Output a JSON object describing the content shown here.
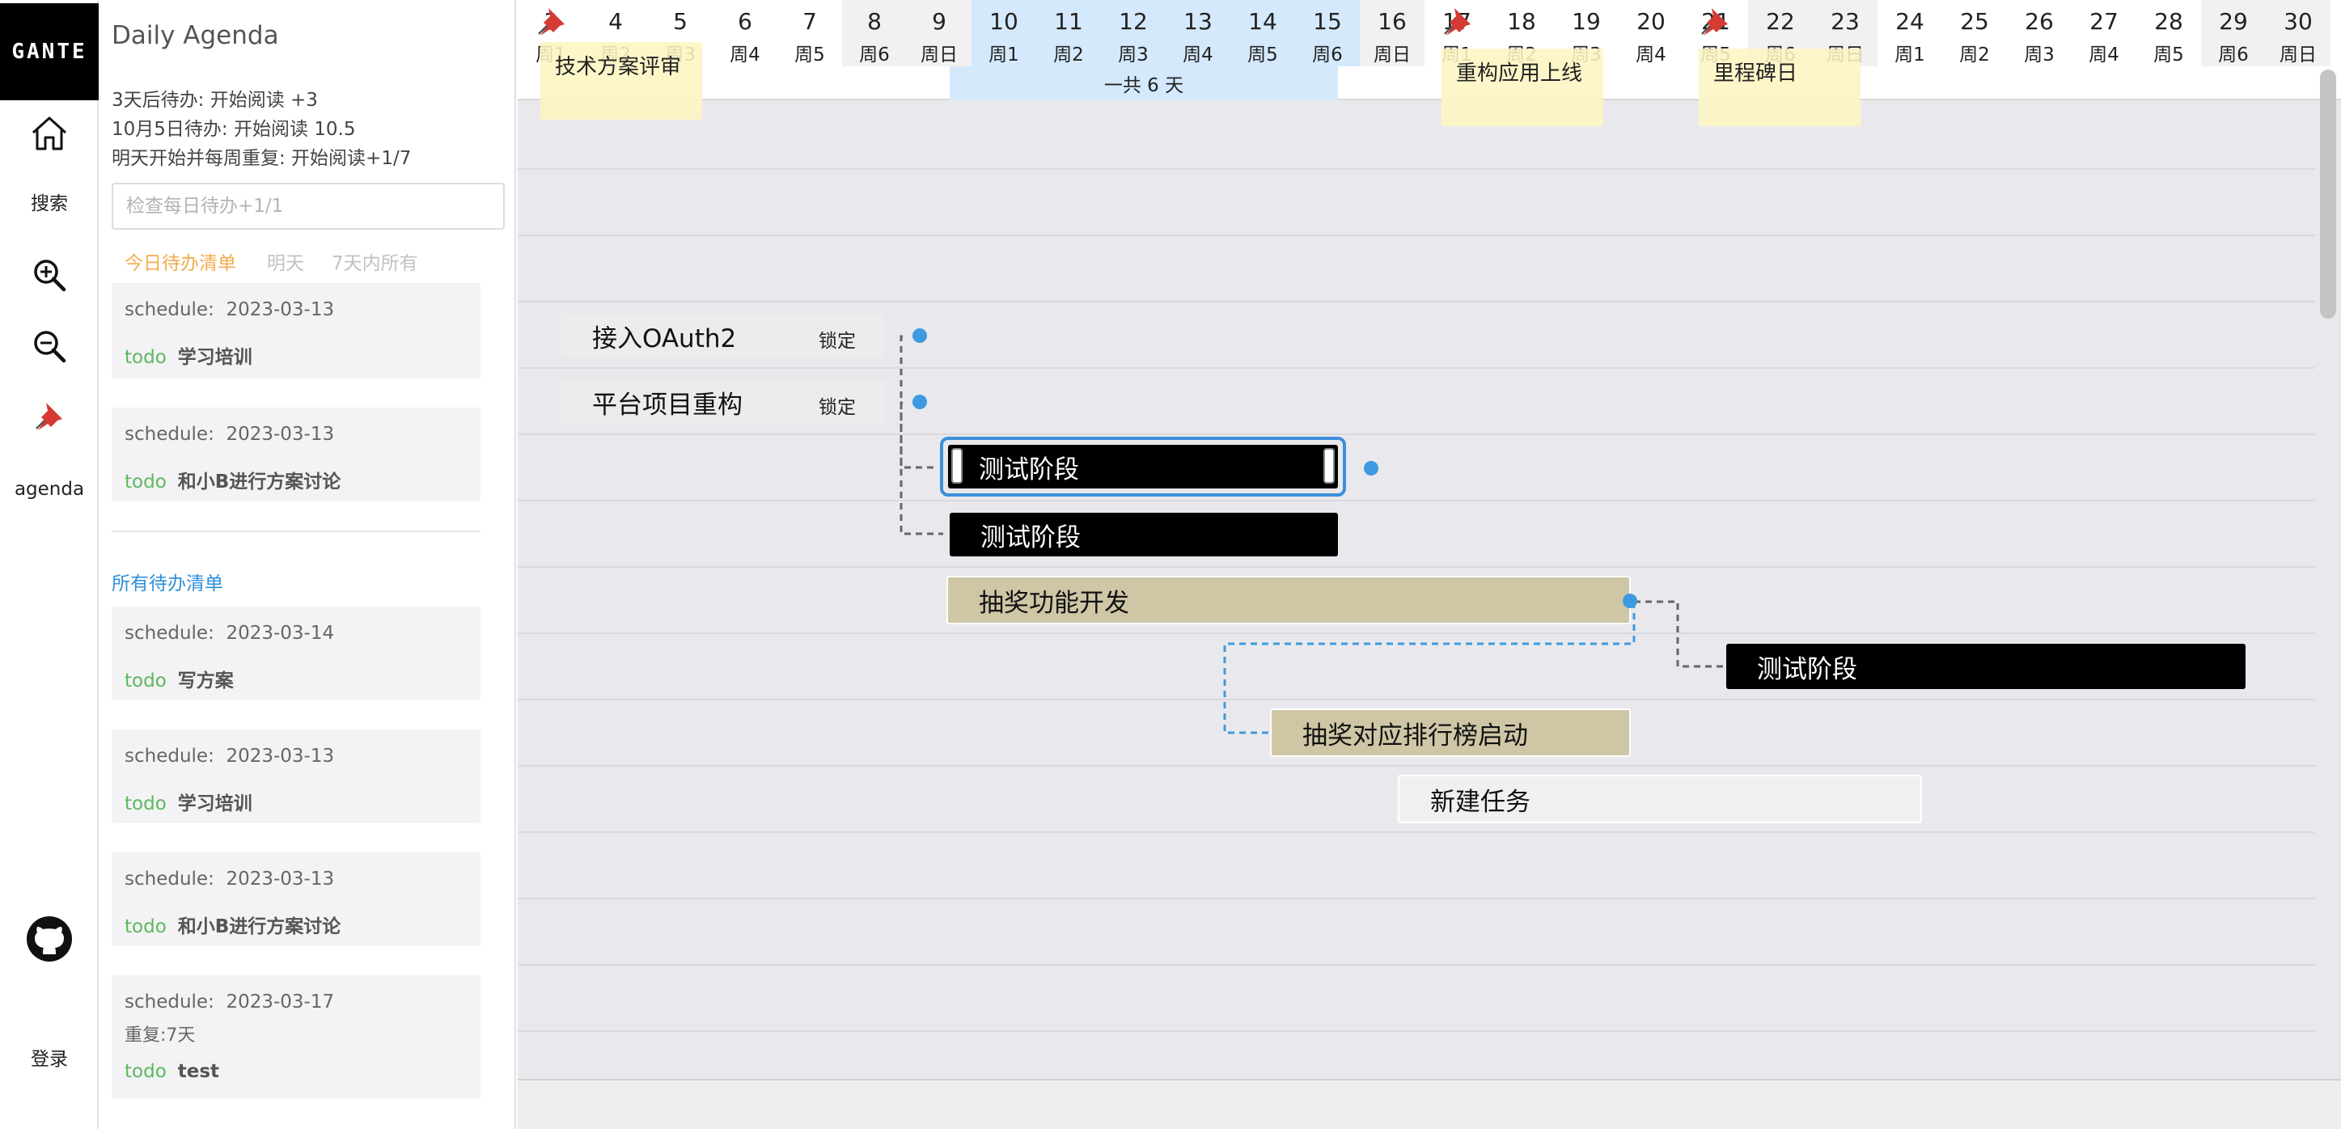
{
  "app": {
    "logo_text": "GANTE",
    "nav": {
      "home_label": "",
      "search_label": "搜索",
      "agenda_label": "agenda",
      "login_label": "登录"
    }
  },
  "agenda": {
    "title": "Daily Agenda",
    "hints": [
      "3天后待办: 开始阅读 +3",
      "10月5日待办: 开始阅读 10.5",
      "明天开始并每周重复: 开始阅读+1/7"
    ],
    "input_placeholder": "检查每日待办+1/1",
    "tabs": {
      "today": "今日待办清单",
      "tomorrow": "明天",
      "week": "7天内所有"
    },
    "schedule_prefix": "schedule:",
    "todo_keyword": "todo",
    "today_items": [
      {
        "date": "2023-03-13",
        "name": "学习培训"
      },
      {
        "date": "2023-03-13",
        "name": "和小B进行方案讨论"
      }
    ],
    "all_title": "所有待办清单",
    "all_items": [
      {
        "date": "2023-03-14",
        "name": "写方案",
        "repeat": ""
      },
      {
        "date": "2023-03-13",
        "name": "学习培训",
        "repeat": ""
      },
      {
        "date": "2023-03-13",
        "name": "和小B进行方案讨论",
        "repeat": ""
      },
      {
        "date": "2023-03-17",
        "name": "test",
        "repeat": "重复:7天"
      }
    ]
  },
  "gantt": {
    "days": [
      {
        "num": "3",
        "wd": "周1",
        "weekend": false
      },
      {
        "num": "4",
        "wd": "周2",
        "weekend": false
      },
      {
        "num": "5",
        "wd": "周3",
        "weekend": false
      },
      {
        "num": "6",
        "wd": "周4",
        "weekend": false
      },
      {
        "num": "7",
        "wd": "周5",
        "weekend": false
      },
      {
        "num": "8",
        "wd": "周6",
        "weekend": true
      },
      {
        "num": "9",
        "wd": "周日",
        "weekend": true
      },
      {
        "num": "10",
        "wd": "周1",
        "weekend": false,
        "selected": true
      },
      {
        "num": "11",
        "wd": "周2",
        "weekend": false,
        "selected": true
      },
      {
        "num": "12",
        "wd": "周3",
        "weekend": false,
        "selected": true
      },
      {
        "num": "13",
        "wd": "周4",
        "weekend": false,
        "selected": true
      },
      {
        "num": "14",
        "wd": "周5",
        "weekend": false,
        "selected": true
      },
      {
        "num": "15",
        "wd": "周6",
        "weekend": true,
        "selected": true
      },
      {
        "num": "16",
        "wd": "周日",
        "weekend": true
      },
      {
        "num": "17",
        "wd": "周1",
        "weekend": false
      },
      {
        "num": "18",
        "wd": "周2",
        "weekend": false
      },
      {
        "num": "19",
        "wd": "周3",
        "weekend": false
      },
      {
        "num": "20",
        "wd": "周4",
        "weekend": false
      },
      {
        "num": "21",
        "wd": "周5",
        "weekend": false
      },
      {
        "num": "22",
        "wd": "周6",
        "weekend": true
      },
      {
        "num": "23",
        "wd": "周日",
        "weekend": true
      },
      {
        "num": "24",
        "wd": "周1",
        "weekend": false
      },
      {
        "num": "25",
        "wd": "周2",
        "weekend": false
      },
      {
        "num": "26",
        "wd": "周3",
        "weekend": false
      },
      {
        "num": "27",
        "wd": "周4",
        "weekend": false
      },
      {
        "num": "28",
        "wd": "周5",
        "weekend": false
      },
      {
        "num": "29",
        "wd": "周6",
        "weekend": true
      },
      {
        "num": "30",
        "wd": "周日",
        "weekend": true
      }
    ],
    "range_label": "一共 6 天",
    "milestones": [
      "技术方案评审",
      "重构应用上线",
      "里程碑日"
    ],
    "lock_label": "锁定",
    "tasks": {
      "oauth": "接入OAuth2",
      "refactor": "平台项目重构",
      "test1": "测试阶段",
      "test2": "测试阶段",
      "lottery": "抽奖功能开发",
      "test3": "测试阶段",
      "ranking": "抽奖对应排行榜启动",
      "new_task": "新建任务"
    },
    "colors": {
      "accent": "#3d9ae0",
      "selected_range": "#d4e9fb",
      "milestone_note": "#fdf5c2",
      "task_khaki": "#cfc6a6"
    }
  }
}
